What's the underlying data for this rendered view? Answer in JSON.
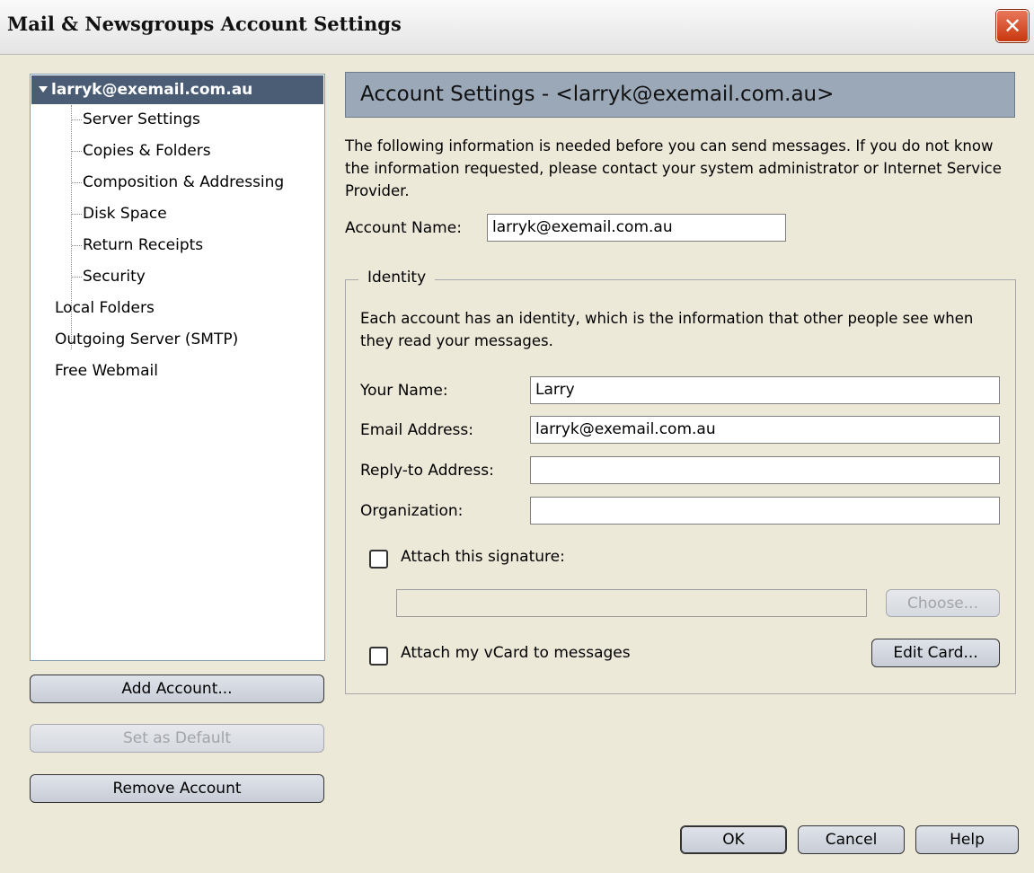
{
  "window": {
    "title": "Mail & Newsgroups Account Settings",
    "close_label": "✕"
  },
  "tree": {
    "account": "larryk@exemail.com.au",
    "children": [
      "Server Settings",
      "Copies & Folders",
      "Composition & Addressing",
      "Disk Space",
      "Return Receipts",
      "Security"
    ],
    "others": [
      "Local Folders",
      "Outgoing Server (SMTP)",
      "Free Webmail"
    ]
  },
  "left_buttons": {
    "add_account": "Add Account...",
    "set_default": "Set as Default",
    "remove_account": "Remove Account"
  },
  "panel": {
    "title": "Account Settings - <larryk@exemail.com.au>",
    "intro": "The following information is needed before you can send messages. If you do not know the information requested, please contact your system administrator or Internet Service Provider.",
    "account_name_label": "Account Name:",
    "account_name_value": "larryk@exemail.com.au",
    "identity": {
      "legend": "Identity",
      "description": "Each account has an identity, which is the information that other people see when they read your messages.",
      "your_name_label": "Your Name:",
      "your_name_value": "Larry",
      "email_label": "Email Address:",
      "email_value": "larryk@exemail.com.au",
      "reply_to_label": "Reply-to Address:",
      "reply_to_value": "",
      "organization_label": "Organization:",
      "organization_value": "",
      "attach_signature_label": "Attach this signature:",
      "attach_signature_checked": false,
      "signature_path": "",
      "choose_label": "Choose...",
      "attach_vcard_label": "Attach my vCard to messages",
      "attach_vcard_checked": false,
      "edit_card_label": "Edit Card..."
    }
  },
  "dialog_buttons": {
    "ok": "OK",
    "cancel": "Cancel",
    "help": "Help"
  },
  "colors": {
    "selected_row": "#4b5d75",
    "header_panel": "#9aa8b8",
    "close_button": "#d9542c"
  }
}
